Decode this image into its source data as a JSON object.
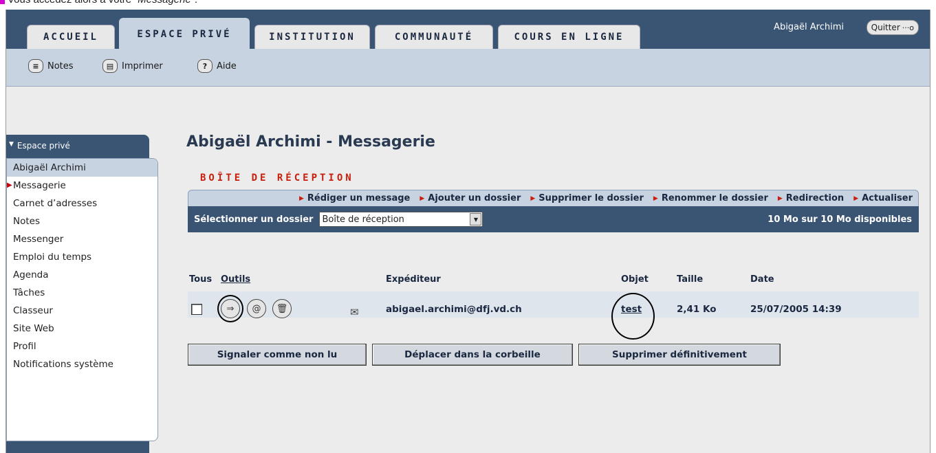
{
  "caption": {
    "prefix": "Vous accédez alors à votre",
    "emphasis": "“Messagerie”",
    "suffix": ".",
    "bullet_color": "#d400d4"
  },
  "header": {
    "tabs": [
      "ACCUEIL",
      "ESPACE PRIVÉ",
      "INSTITUTION",
      "COMMUNAUTÉ",
      "COURS EN LIGNE"
    ],
    "active_tab": "ESPACE PRIVÉ",
    "user_name": "Abigaël Archimi",
    "quit_label": "Quitter",
    "quit_icon": "power-icon"
  },
  "toolbar": {
    "items": [
      {
        "label": "Notes",
        "icon": "notes-icon"
      },
      {
        "label": "Imprimer",
        "icon": "print-icon"
      },
      {
        "label": "Aide",
        "icon": "help-icon"
      }
    ]
  },
  "sidebar": {
    "header": "Espace privé",
    "user": "Abigaël Archimi",
    "items": [
      "Messagerie",
      "Carnet d’adresses",
      "Notes",
      "Messenger",
      "Emploi du temps",
      "Agenda",
      "Tâches",
      "Classeur",
      "Site Web",
      "Profil",
      "Notifications système"
    ],
    "active_item": "Messagerie"
  },
  "main": {
    "title": "Abigaël Archimi - Messagerie",
    "subtitle": "BOÎTE DE RÉCEPTION",
    "actions": [
      "Rédiger un message",
      "Ajouter un dossier",
      "Supprimer le dossier",
      "Renommer le dossier",
      "Redirection",
      "Actualiser"
    ],
    "folder_label": "Sélectionner un dossier",
    "folder_value": "Boîte de réception",
    "quota": "10 Mo sur 10 Mo disponibles",
    "columns": {
      "all": "Tous",
      "tools": "Outils",
      "sender": "Expéditeur",
      "subject": "Objet",
      "size": "Taille",
      "date": "Date"
    },
    "message": {
      "sender": "abigael.archimi@dfj.vd.ch",
      "subject": "test",
      "size": "2,41 Ko",
      "date": "25/07/2005 14:39",
      "tool_icons": [
        "forward-icon",
        "reply-icon",
        "trash-icon"
      ],
      "status_icon": "envelope-icon"
    },
    "buttons": [
      "Signaler comme non lu",
      "Déplacer dans la corbeille",
      "Supprimer définitivement"
    ]
  },
  "colors": {
    "header_bg": "#3a5474",
    "light_bg": "#c7d3e1",
    "accent_red": "#c81e0a"
  }
}
